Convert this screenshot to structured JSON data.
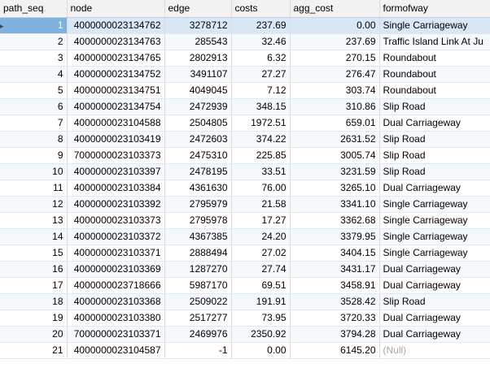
{
  "columns": [
    "path_seq",
    "node",
    "edge",
    "costs",
    "agg_cost",
    "formofway"
  ],
  "selected_row_marker": "▸",
  "rows": [
    {
      "path_seq": "1",
      "node": "4000000023134762",
      "edge": "3278712",
      "costs": "237.69",
      "agg_cost": "0.00",
      "formofway": "Single Carriageway"
    },
    {
      "path_seq": "2",
      "node": "4000000023134763",
      "edge": "285543",
      "costs": "32.46",
      "agg_cost": "237.69",
      "formofway": "Traffic Island Link At Ju"
    },
    {
      "path_seq": "3",
      "node": "4000000023134765",
      "edge": "2802913",
      "costs": "6.32",
      "agg_cost": "270.15",
      "formofway": "Roundabout"
    },
    {
      "path_seq": "4",
      "node": "4000000023134752",
      "edge": "3491107",
      "costs": "27.27",
      "agg_cost": "276.47",
      "formofway": "Roundabout"
    },
    {
      "path_seq": "5",
      "node": "4000000023134751",
      "edge": "4049045",
      "costs": "7.12",
      "agg_cost": "303.74",
      "formofway": "Roundabout"
    },
    {
      "path_seq": "6",
      "node": "4000000023134754",
      "edge": "2472939",
      "costs": "348.15",
      "agg_cost": "310.86",
      "formofway": "Slip Road"
    },
    {
      "path_seq": "7",
      "node": "4000000023104588",
      "edge": "2504805",
      "costs": "1972.51",
      "agg_cost": "659.01",
      "formofway": "Dual Carriageway"
    },
    {
      "path_seq": "8",
      "node": "4000000023103419",
      "edge": "2472603",
      "costs": "374.22",
      "agg_cost": "2631.52",
      "formofway": "Slip Road"
    },
    {
      "path_seq": "9",
      "node": "7000000023103373",
      "edge": "2475310",
      "costs": "225.85",
      "agg_cost": "3005.74",
      "formofway": "Slip Road"
    },
    {
      "path_seq": "10",
      "node": "4000000023103397",
      "edge": "2478195",
      "costs": "33.51",
      "agg_cost": "3231.59",
      "formofway": "Slip Road"
    },
    {
      "path_seq": "11",
      "node": "4000000023103384",
      "edge": "4361630",
      "costs": "76.00",
      "agg_cost": "3265.10",
      "formofway": "Dual Carriageway"
    },
    {
      "path_seq": "12",
      "node": "4000000023103392",
      "edge": "2795979",
      "costs": "21.58",
      "agg_cost": "3341.10",
      "formofway": "Single Carriageway"
    },
    {
      "path_seq": "13",
      "node": "4000000023103373",
      "edge": "2795978",
      "costs": "17.27",
      "agg_cost": "3362.68",
      "formofway": "Single Carriageway"
    },
    {
      "path_seq": "14",
      "node": "4000000023103372",
      "edge": "4367385",
      "costs": "24.20",
      "agg_cost": "3379.95",
      "formofway": "Single Carriageway"
    },
    {
      "path_seq": "15",
      "node": "4000000023103371",
      "edge": "2888494",
      "costs": "27.02",
      "agg_cost": "3404.15",
      "formofway": "Single Carriageway"
    },
    {
      "path_seq": "16",
      "node": "4000000023103369",
      "edge": "1287270",
      "costs": "27.74",
      "agg_cost": "3431.17",
      "formofway": "Dual Carriageway"
    },
    {
      "path_seq": "17",
      "node": "4000000023718666",
      "edge": "5987170",
      "costs": "69.51",
      "agg_cost": "3458.91",
      "formofway": "Dual Carriageway"
    },
    {
      "path_seq": "18",
      "node": "4000000023103368",
      "edge": "2509022",
      "costs": "191.91",
      "agg_cost": "3528.42",
      "formofway": "Slip Road"
    },
    {
      "path_seq": "19",
      "node": "4000000023103380",
      "edge": "2517277",
      "costs": "73.95",
      "agg_cost": "3720.33",
      "formofway": "Dual Carriageway"
    },
    {
      "path_seq": "20",
      "node": "7000000023103371",
      "edge": "2469976",
      "costs": "2350.92",
      "agg_cost": "3794.28",
      "formofway": "Dual Carriageway"
    },
    {
      "path_seq": "21",
      "node": "4000000023104587",
      "edge": "-1",
      "costs": "0.00",
      "agg_cost": "6145.20",
      "formofway": "(Null)"
    }
  ]
}
